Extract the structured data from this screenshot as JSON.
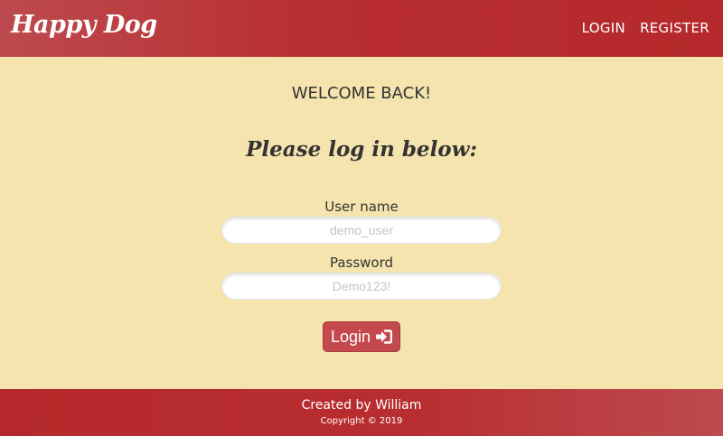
{
  "navbar": {
    "brand": "Happy Dog",
    "links": [
      "LOGIN",
      "REGISTER"
    ]
  },
  "main": {
    "heading": "WELCOME BACK!",
    "subtitle": "Please log in below:",
    "form": {
      "username_label": "User name",
      "username_placeholder": "demo_user",
      "password_label": "Password",
      "password_placeholder": "Demo123!",
      "submit_label": "Login",
      "submit_icon": "sign-in-icon"
    }
  },
  "footer": {
    "credit": "Created by William",
    "copyright": "Copyright © 2019"
  },
  "colors": {
    "header_red": "#b5292c",
    "page_bg": "#f5e4ad",
    "button_red": "#c4494d",
    "text_dark": "#333333"
  }
}
